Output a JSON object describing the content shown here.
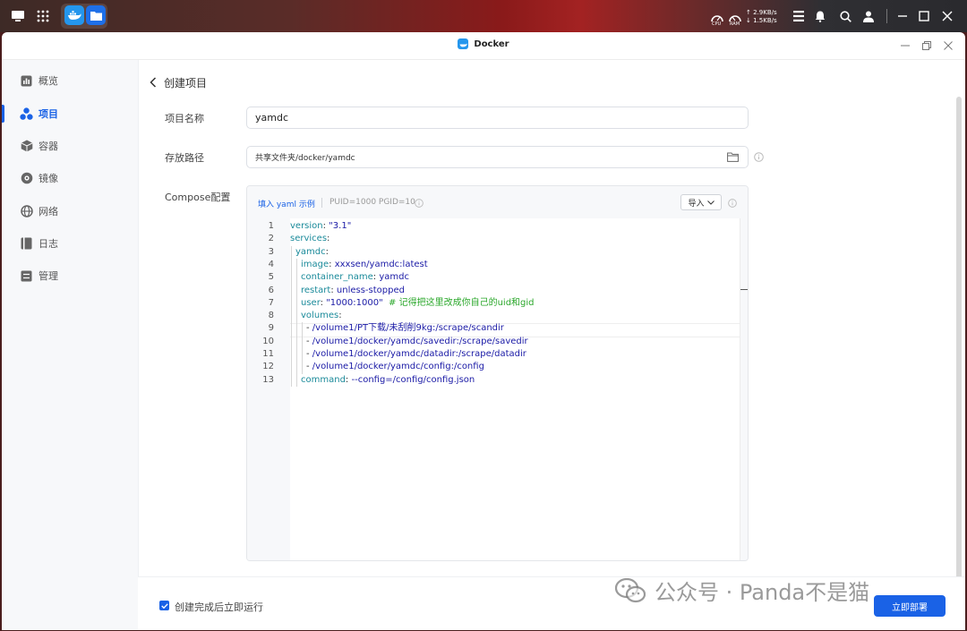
{
  "desktop_bar": {
    "apps": [
      "main-menu",
      "app-grid",
      "docker",
      "file-manager"
    ],
    "cpu_label": "CPU",
    "ram_label": "RAM",
    "net_up": "↑ 2.9KB/s",
    "net_down": "↓ 1.5KB/s"
  },
  "window": {
    "title": "Docker"
  },
  "sidebar": {
    "items": [
      {
        "label": "概览",
        "icon": "overview-icon"
      },
      {
        "label": "项目",
        "icon": "project-icon"
      },
      {
        "label": "容器",
        "icon": "container-icon"
      },
      {
        "label": "镜像",
        "icon": "image-icon"
      },
      {
        "label": "网络",
        "icon": "network-icon"
      },
      {
        "label": "日志",
        "icon": "log-icon"
      },
      {
        "label": "管理",
        "icon": "manage-icon"
      }
    ],
    "active_index": 1
  },
  "page": {
    "title": "创建项目",
    "project_name_label": "项目名称",
    "project_name_value": "yamdc",
    "path_label": "存放路径",
    "path_value": "共享文件夹/docker/yamdc",
    "compose_label": "Compose配置",
    "fill_example_link": "填入 yaml 示例",
    "puid_hint": "PUID=1000 PGID=10",
    "import_label": "导入"
  },
  "editor": {
    "lines": [
      {
        "n": "1",
        "indent": 0,
        "key": "version",
        "sep": ": ",
        "val": "\"3.1\"",
        "comment": ""
      },
      {
        "n": "2",
        "indent": 0,
        "key": "services",
        "sep": ":",
        "val": "",
        "comment": ""
      },
      {
        "n": "3",
        "indent": 1,
        "key": "yamdc",
        "sep": ":",
        "val": "",
        "comment": ""
      },
      {
        "n": "4",
        "indent": 2,
        "key": "image",
        "sep": ": ",
        "val": "xxxsen/yamdc:latest",
        "comment": ""
      },
      {
        "n": "5",
        "indent": 2,
        "key": "container_name",
        "sep": ": ",
        "val": "yamdc",
        "comment": ""
      },
      {
        "n": "6",
        "indent": 2,
        "key": "restart",
        "sep": ": ",
        "val": "unless-stopped",
        "comment": ""
      },
      {
        "n": "7",
        "indent": 2,
        "key": "user",
        "sep": ": ",
        "val": "\"1000:1000\"",
        "comment": "  # 记得把这里改成你自己的uid和gid"
      },
      {
        "n": "8",
        "indent": 2,
        "key": "volumes",
        "sep": ":",
        "val": "",
        "comment": ""
      },
      {
        "n": "9",
        "indent": 3,
        "key": "",
        "sep": "- ",
        "val": "/volume1/PT下载/未刮削9kg:/scrape/scandir",
        "comment": ""
      },
      {
        "n": "10",
        "indent": 3,
        "key": "",
        "sep": "- ",
        "val": "/volume1/docker/yamdc/savedir:/scrape/savedir",
        "comment": ""
      },
      {
        "n": "11",
        "indent": 3,
        "key": "",
        "sep": "- ",
        "val": "/volume1/docker/yamdc/datadir:/scrape/datadir",
        "comment": ""
      },
      {
        "n": "12",
        "indent": 3,
        "key": "",
        "sep": "- ",
        "val": "/volume1/docker/yamdc/config:/config",
        "comment": ""
      },
      {
        "n": "13",
        "indent": 2,
        "key": "command",
        "sep": ": ",
        "val": "--config=/config/config.json",
        "comment": ""
      }
    ]
  },
  "footer": {
    "run_after_create_label": "创建完成后立即运行",
    "run_after_create_checked": true,
    "deploy_label": "立即部署"
  },
  "watermark": {
    "text": "公众号 · Panda不是猫"
  },
  "colors": {
    "accent": "#1a62e6",
    "code_key": "#1a8a9a",
    "code_string": "#1a1aa6",
    "code_comment": "#2aa72a"
  }
}
